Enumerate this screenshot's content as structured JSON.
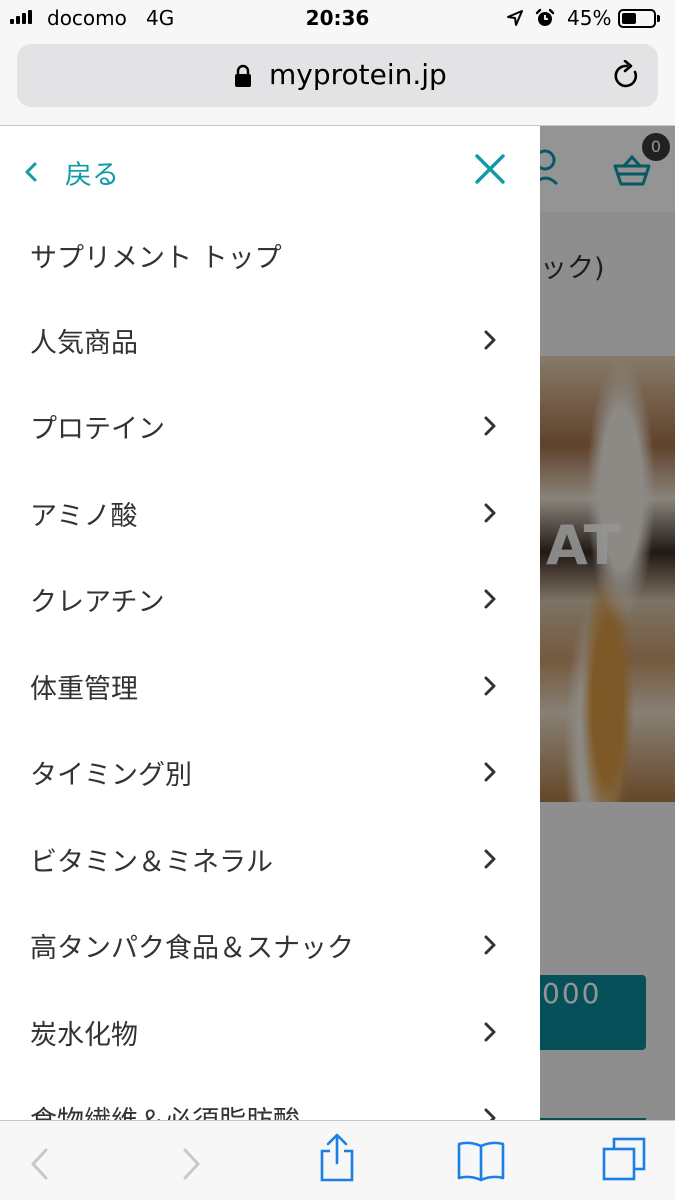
{
  "status_bar": {
    "carrier": "docomo",
    "network": "4G",
    "time": "20:36",
    "battery_percent": "45%",
    "battery_level": 0.45
  },
  "browser": {
    "url": "myprotein.jp"
  },
  "background_page": {
    "cart_count": "0",
    "title_fragment": "ック)",
    "image_text": "AT",
    "button_fragment": "000"
  },
  "drawer": {
    "back_label": "戻る",
    "items": [
      {
        "label": "サプリメント トップ",
        "has_arrow": false
      },
      {
        "label": "人気商品",
        "has_arrow": true
      },
      {
        "label": "プロテイン",
        "has_arrow": true
      },
      {
        "label": "アミノ酸",
        "has_arrow": true
      },
      {
        "label": "クレアチン",
        "has_arrow": true
      },
      {
        "label": "体重管理",
        "has_arrow": true
      },
      {
        "label": "タイミング別",
        "has_arrow": true
      },
      {
        "label": "ビタミン＆ミネラル",
        "has_arrow": true
      },
      {
        "label": "高タンパク食品＆スナック",
        "has_arrow": true
      },
      {
        "label": "炭水化物",
        "has_arrow": true
      },
      {
        "label": "食物繊維＆必須脂肪酸",
        "has_arrow": true
      }
    ]
  },
  "icons": {
    "accent_color": "#0e9aa7",
    "toolbar_color": "#1a7fe6"
  }
}
